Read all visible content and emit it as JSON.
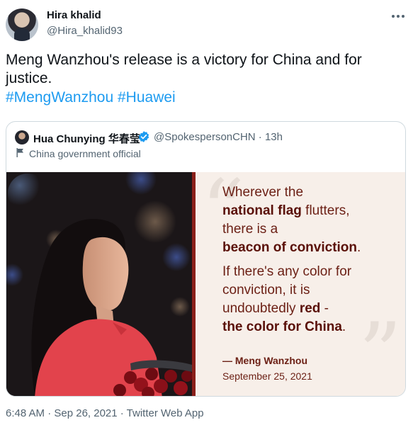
{
  "author": {
    "display_name": "Hira khalid",
    "handle": "@Hira_khalid93"
  },
  "tweet": {
    "text": "Meng Wanzhou's release is a victory for China and for justice.",
    "hashtags": [
      "#MengWanzhou",
      "#Huawei"
    ]
  },
  "quoted_tweet": {
    "display_name": "Hua Chunying 华春莹",
    "verified": true,
    "handle": "@SpokespersonCHN",
    "separator": "·",
    "time": "13h",
    "label": "China government official",
    "image_quote": {
      "lines": [
        [
          {
            "t": "Wherever the",
            "b": false
          }
        ],
        [
          {
            "t": "national flag",
            "b": true
          },
          {
            "t": " flutters,",
            "b": false
          }
        ],
        [
          {
            "t": "there is a",
            "b": false
          }
        ],
        [
          {
            "t": "beacon of conviction",
            "b": true
          },
          {
            "t": ".",
            "b": false
          }
        ],
        [
          {
            "t": "If there's any color for",
            "b": false
          }
        ],
        [
          {
            "t": "conviction, it is",
            "b": false
          }
        ],
        [
          {
            "t": "undoubtedly ",
            "b": false
          },
          {
            "t": "red",
            "b": true
          },
          {
            "t": " -",
            "b": false
          }
        ],
        [
          {
            "t": "the color for China",
            "b": true
          },
          {
            "t": ".",
            "b": false
          }
        ]
      ],
      "attribution_name": "— Meng Wanzhou",
      "attribution_date": "September 25, 2021"
    }
  },
  "footer": {
    "timestamp": "6:48 AM · Sep 26, 2021 · Twitter Web App"
  },
  "colors": {
    "link_blue": "#1d9bf0",
    "quote_text": "#6b1f14",
    "quote_bg": "#f7efe9",
    "muted_text": "#536471"
  },
  "icons": [
    "more-icon",
    "verified-badge-icon",
    "government-flag-icon"
  ]
}
